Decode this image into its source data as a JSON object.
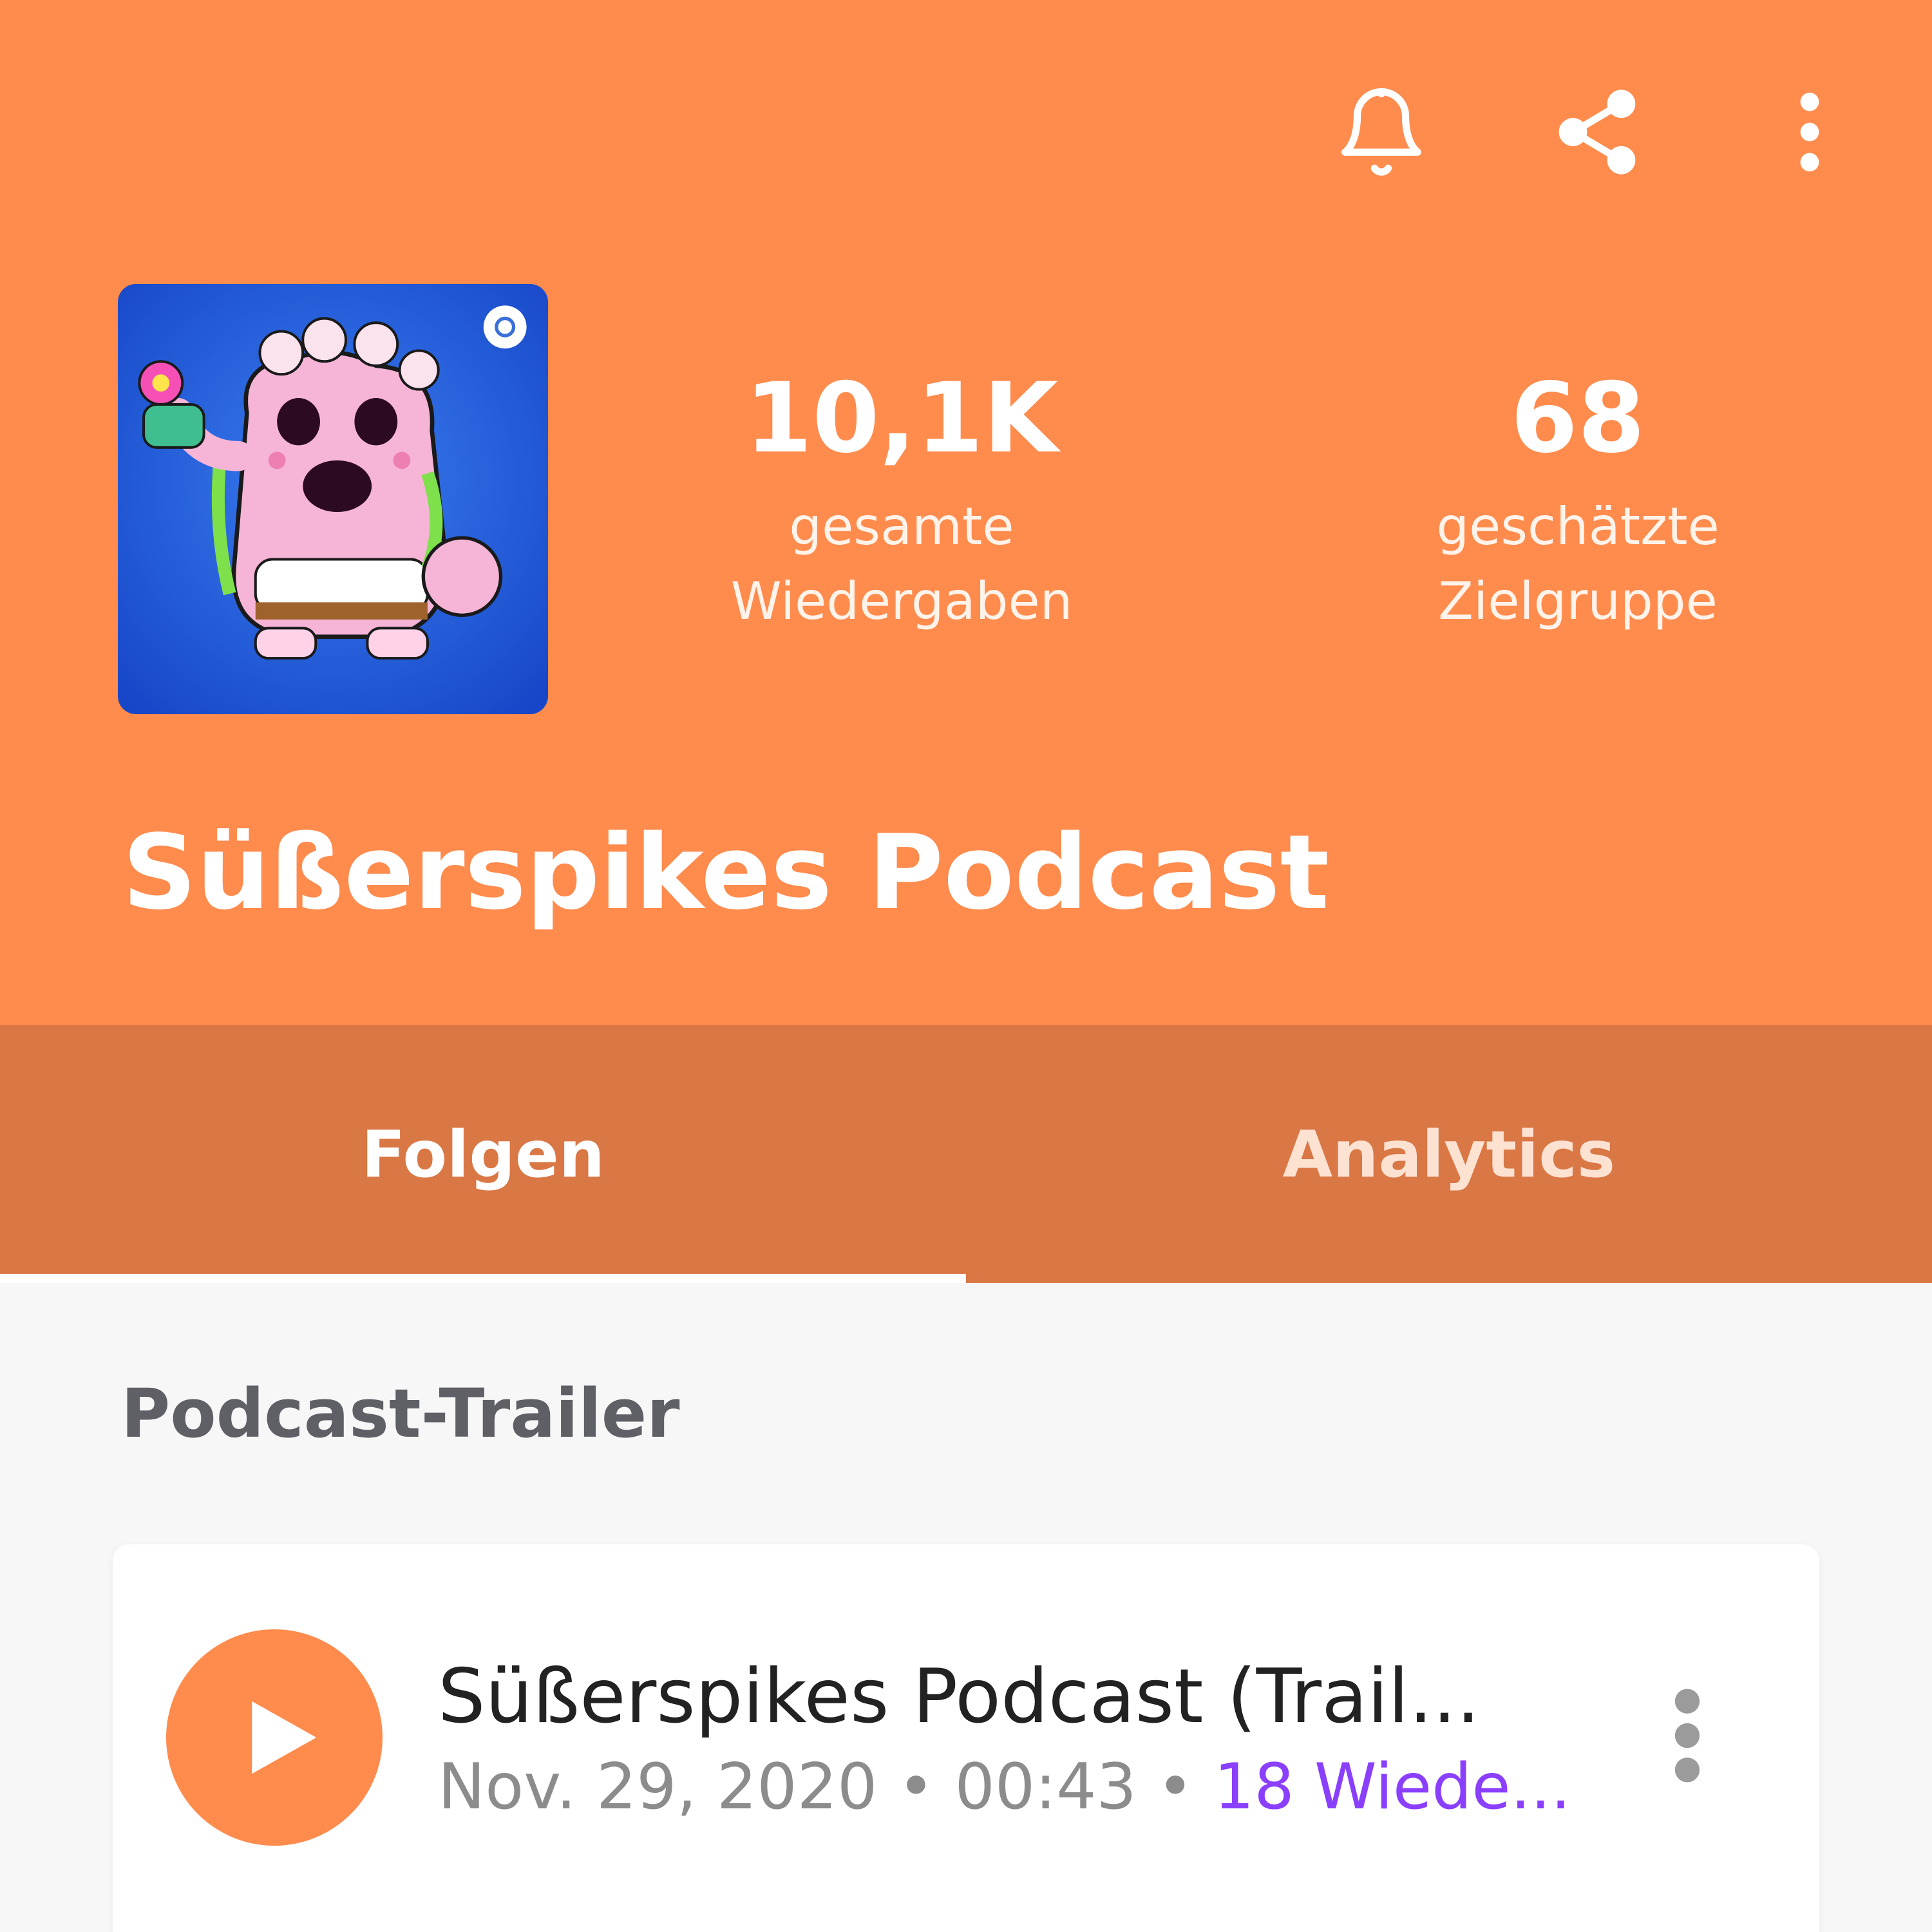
{
  "theme": {
    "header_color": "#ff8b4d",
    "tabbar_color": "#d97745",
    "accent_purple": "#8a3ffc",
    "background": "#f7f7f7"
  },
  "toolbar": {
    "icons": [
      "bell-icon",
      "share-icon",
      "more-vertical-icon"
    ]
  },
  "podcast": {
    "title": "Süßerspikes Podcast",
    "cover_icon": "podcast-cover-image",
    "stats": [
      {
        "value": "10,1K",
        "label_line1": "gesamte",
        "label_line2": "Wiedergaben"
      },
      {
        "value": "68",
        "label_line1": "geschätzte",
        "label_line2": "Zielgruppe"
      }
    ]
  },
  "tabs": [
    {
      "label": "Folgen",
      "active": true
    },
    {
      "label": "Analytics",
      "active": false
    }
  ],
  "section": {
    "title": "Podcast-Trailer"
  },
  "episode": {
    "title": "Süßerspikes Podcast (Trail...",
    "date": "Nov. 29, 2020",
    "duration": "00:43",
    "plays": "18 Wiede...",
    "separator": " • "
  }
}
